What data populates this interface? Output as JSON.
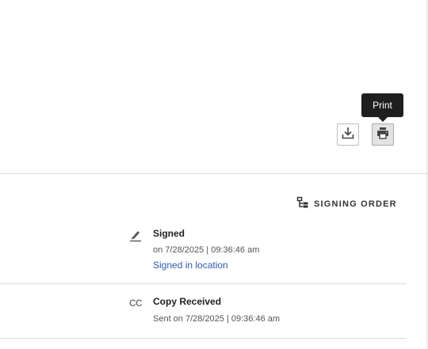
{
  "toolbar": {
    "tooltip": "Print",
    "download_icon": "download-icon",
    "print_icon": "printer-icon"
  },
  "signing_order": {
    "icon": "hierarchy-icon",
    "label": "SIGNING ORDER"
  },
  "events": [
    {
      "icon": "signature-pen-icon",
      "title": "Signed",
      "time": "on 7/28/2025 | 09:36:46 am",
      "link": "Signed in location"
    },
    {
      "icon": "cc-icon",
      "icon_text": "CC",
      "title": "Copy Received",
      "time": "Sent on 7/28/2025 | 09:36:46 am"
    }
  ],
  "colors": {
    "link": "#2f5aa8",
    "tooltip_bg": "#1f1f1f",
    "divider": "#dcdcdc"
  }
}
